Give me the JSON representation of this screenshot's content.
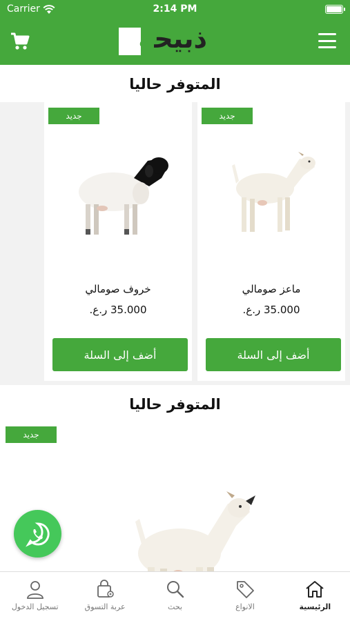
{
  "status_bar": {
    "carrier": "Carrier",
    "time": "2:14 PM"
  },
  "header": {
    "logo_text": "ذبيحة"
  },
  "sections": [
    {
      "title": "المتوفر حاليا",
      "cards": [
        {
          "badge": "جديد",
          "name": "ماعز صومالي",
          "price": "35.000 ر.ع.",
          "button": "أضف إلى السلة",
          "image": "goat-icon"
        },
        {
          "badge": "جديد",
          "name": "خروف صومالي",
          "price": "35.000 ر.ع.",
          "button": "أضف إلى السلة",
          "image": "sheep-icon"
        }
      ]
    },
    {
      "title": "المتوفر حاليا",
      "cards": [
        {
          "badge": "جديد",
          "image": "goat-icon"
        }
      ]
    }
  ],
  "tab_bar": {
    "items": [
      {
        "label": "الرئيسية",
        "icon": "home-icon",
        "active": true
      },
      {
        "label": "الانواع",
        "icon": "tag-icon",
        "active": false
      },
      {
        "label": "بحث",
        "icon": "search-icon",
        "active": false
      },
      {
        "label": "عربة التسوق",
        "icon": "shopping-bag-icon",
        "active": false
      },
      {
        "label": "تسجيل الدخول",
        "icon": "user-icon",
        "active": false
      }
    ]
  },
  "colors": {
    "brand": "#45a83c",
    "whatsapp": "#45c85a"
  }
}
